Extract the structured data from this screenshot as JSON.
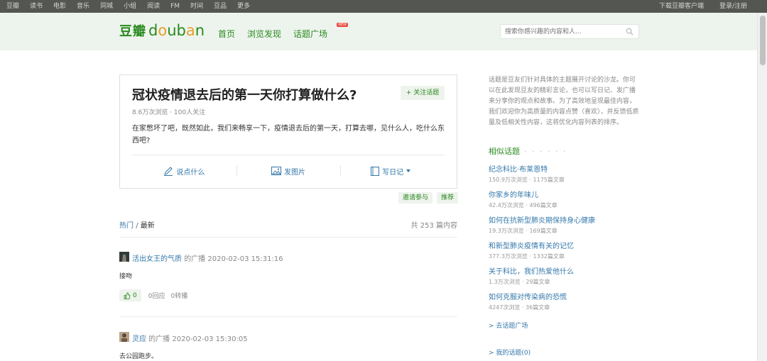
{
  "topnav": {
    "left": [
      "豆瓣",
      "读书",
      "电影",
      "音乐",
      "同城",
      "小组",
      "阅读",
      "FM",
      "时间",
      "豆品",
      "更多"
    ],
    "right": [
      "下载豆瓣客户端",
      "登录/注册"
    ]
  },
  "header": {
    "logo_cn": "豆瓣",
    "logo_en_parts": [
      "d",
      "o",
      "u",
      "b",
      "a",
      "n"
    ],
    "nav": [
      "首页",
      "浏览发现",
      "话题广场"
    ],
    "new_badge": "NEW",
    "search_placeholder": "搜索你感兴趣的内容和人..."
  },
  "topic": {
    "title": "冠状疫情退去后的第一天你打算做什么?",
    "follow_label": "+ 关注话题",
    "stats": "8.6万次浏览 · 100人关注",
    "description": "在家憋坏了吧，既然如此，我们来畅享一下，疫情退去后的第一天，打算去哪，见什么人，吃什么东西吧?",
    "actions": [
      "说点什么",
      "发图片",
      "写日记"
    ]
  },
  "tag_buttons": [
    "邀请参与",
    "推荐"
  ],
  "sort": {
    "hot": "热门",
    "separator": "/",
    "latest": "最新",
    "total": "共 253 篇内容"
  },
  "posts": [
    {
      "author": "活出女王的气质",
      "meta": "的广播 2020-02-03 15:31:16",
      "body": "接吻",
      "likes": "0",
      "replies": "0回应",
      "reshares": "0转播"
    },
    {
      "author": "灵应",
      "meta": "的广播 2020-02-03 15:30:05",
      "body": "去公园跑步。"
    }
  ],
  "sidebar": {
    "intro": "话题是豆友们针对具体的主题展开讨论的沙龙。你可以在此发现豆友的精彩言论，也可以写日记、发广播来分享你的观点和故事。为了高效地呈现最佳内容，我们欢迎你为高质量的内容点赞（喜欢），并反馈低质量及低相关性内容，这将优化内容列表的排序。",
    "related_heading": "相似话题",
    "related_dots": "· · · · · ·",
    "related": [
      {
        "title": "纪念科比·布莱恩特",
        "stats": "150.9万次浏览 · 1175篇文章"
      },
      {
        "title": "你家乡的年味儿",
        "stats": "42.4万次浏览 · 496篇文章"
      },
      {
        "title": "如何在抗新型肺炎期保持身心健康",
        "stats": "19.3万次浏览 · 169篇文章"
      },
      {
        "title": "和新型肺炎疫情有关的记忆",
        "stats": "377.3万次浏览 · 1332篇文章"
      },
      {
        "title": "关于科比，我们热爱他什么",
        "stats": "1.3万次浏览 · 29篇文章"
      },
      {
        "title": "如何克服对传染病的恐慌",
        "stats": "4247次浏览 · 36篇文章"
      }
    ],
    "to_square": "> 去话题广场",
    "my_topics": "> 我的话题(0)"
  },
  "colors": {
    "brand_green": "#2a8a1f",
    "link_blue": "#3377aa",
    "topbar": "#545652",
    "header_bg": "#edf4ed"
  }
}
